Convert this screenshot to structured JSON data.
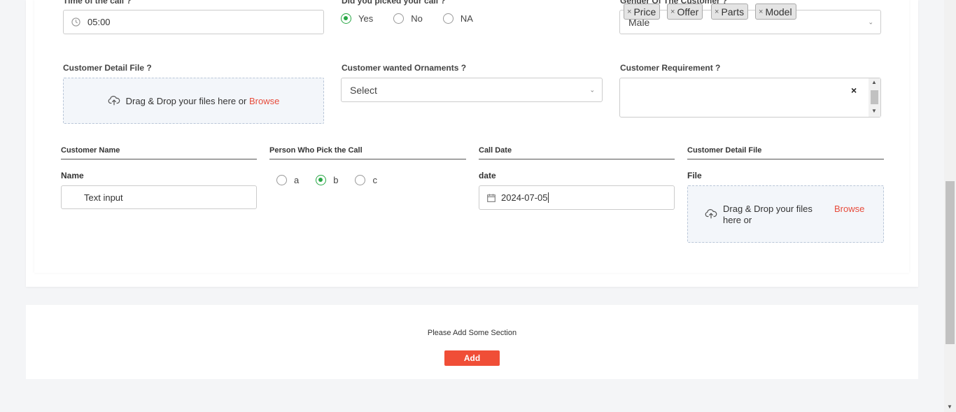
{
  "form1": {
    "time": {
      "label": "Time of the call ?",
      "value": "05:00"
    },
    "picked": {
      "label": "Did you picked your call ?",
      "options": [
        "Yes",
        "No",
        "NA"
      ],
      "selected": "Yes"
    },
    "gender": {
      "label": "Gender Of The Customer ?",
      "value": "Male"
    },
    "file": {
      "label": "Customer Detail File ?",
      "text": "Drag & Drop your files here or",
      "browse": "Browse"
    },
    "ornaments": {
      "label": "Customer wanted Ornaments ?",
      "value": "Select"
    },
    "requirement": {
      "label": "Customer Requirement ?",
      "tags": [
        "Price",
        "Offer",
        "Parts",
        "Model"
      ],
      "tag_remove": "×",
      "clear": "×"
    }
  },
  "form2": {
    "name_section": {
      "heading": "Customer Name",
      "label": "Name",
      "value": "Text input"
    },
    "person_section": {
      "heading": "Person Who Pick the Call",
      "options": [
        "a",
        "b",
        "c"
      ],
      "selected": "b"
    },
    "date_section": {
      "heading": "Call Date",
      "label": "date",
      "value": "2024-07-05"
    },
    "file_section": {
      "heading": "Customer Detail File",
      "label": "File",
      "text": "Drag & Drop your files here or",
      "browse": "Browse"
    }
  },
  "add_section": {
    "message": "Please Add Some Section",
    "button": "Add"
  },
  "colors": {
    "accent_green": "#28a745",
    "browse_red": "#e74c3c",
    "add_button": "#f04e37"
  }
}
